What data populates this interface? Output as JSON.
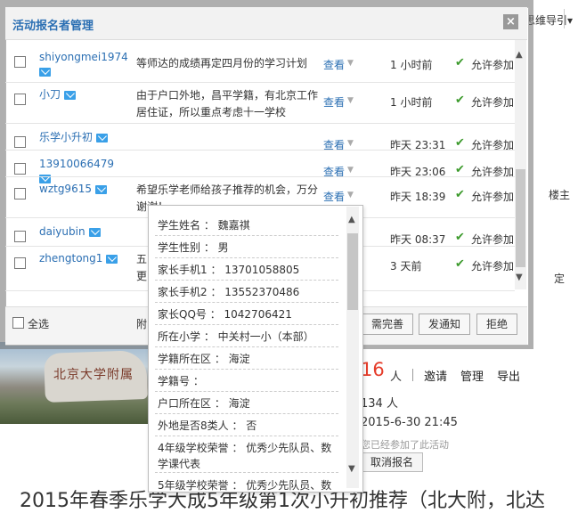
{
  "bg": {
    "nav_label": "思维导引",
    "nav_arrow": "▾",
    "louzhu": "楼主",
    "ding": "定",
    "rock_text": "北京大学附属",
    "signup_count": "16",
    "signup_unit": "人",
    "invite": "邀请",
    "manage": "管理",
    "export": "导出",
    "views": "134 人",
    "date": "2015-6-30 21:45",
    "joined_note": "您已经参加了此活动",
    "cancel_btn": "取消报名",
    "big_title": "2015年春季乐学大成5年级第1次小升初推荐（北大附，北达"
  },
  "dialog": {
    "title": "活动报名者管理",
    "close": "×",
    "view_label": "查看",
    "allow_label": "允许参加",
    "rows": [
      {
        "name": "shiyongmei1974",
        "note": "等师达的成绩再定四月份的学习计划",
        "time": "1 小时前"
      },
      {
        "name": "小刀",
        "note": "由于户口外地，昌平学籍，有北京工作居住证，所以重点考虑十一学校",
        "time": "1 小时前"
      },
      {
        "name": "乐学小升初",
        "note": "",
        "time": "昨天 23:31"
      },
      {
        "name": "13910066479",
        "note": "",
        "time": "昨天 23:06"
      },
      {
        "name": "wztg9615",
        "note": "希望乐学老师给孩子推荐的机会，万分谢谢！",
        "time": "昨天 18:39"
      },
      {
        "name": "daiyubin",
        "note": "",
        "time": "昨天 08:37"
      },
      {
        "name": "zhengtong1",
        "note": "五\n更",
        "time": "3 天前"
      }
    ],
    "select_all": "全选",
    "footer_prefix": "附",
    "btn_need": "需完善",
    "btn_notify": "发通知",
    "btn_reject": "拒绝"
  },
  "popup": {
    "fields": [
      "学生姓名 ： 魏嘉祺",
      "学生性别 ： 男",
      "家长手机1 ： 13701058805",
      "家长手机2 ： 13552370486",
      "家长QQ号 ： 1042706421",
      "所在小学 ： 中关村一小（本部）",
      "学籍所在区 ： 海淀",
      "学籍号 ：",
      "户口所在区 ： 海淀",
      "外地是否8类人 ： 否",
      "4年级学校荣誉 ： 优秀少先队员、数学课代表",
      "5年级学校荣誉 ： 优秀少先队员、数"
    ]
  }
}
